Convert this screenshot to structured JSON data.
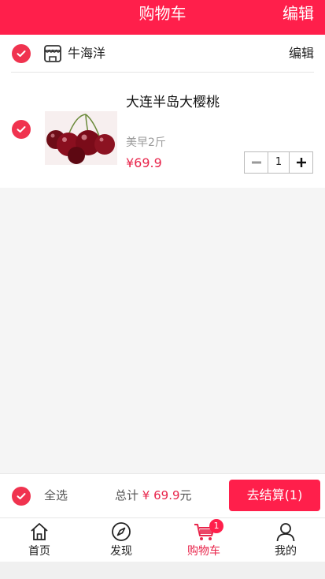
{
  "header": {
    "title": "购物车",
    "edit_label": "编辑"
  },
  "shop": {
    "name": "牛海洋",
    "edit_label": "编辑",
    "icon": "store-icon"
  },
  "item": {
    "title": "大连半岛大樱桃",
    "spec": "美早2斤",
    "price": "¥69.9",
    "quantity": "1",
    "image": "cherries-image"
  },
  "footer": {
    "select_all_label": "全选",
    "total_label": "总计",
    "total_amount": "¥ 69.9",
    "total_unit": "元",
    "checkout_label": "去结算(1)"
  },
  "tabs": [
    {
      "label": "首页",
      "icon": "home-icon"
    },
    {
      "label": "发现",
      "icon": "compass-icon"
    },
    {
      "label": "购物车",
      "icon": "cart-icon",
      "badge": "1",
      "active": true
    },
    {
      "label": "我的",
      "icon": "user-icon"
    }
  ],
  "colors": {
    "accent": "#ff1f4b",
    "price": "#e8254b"
  }
}
